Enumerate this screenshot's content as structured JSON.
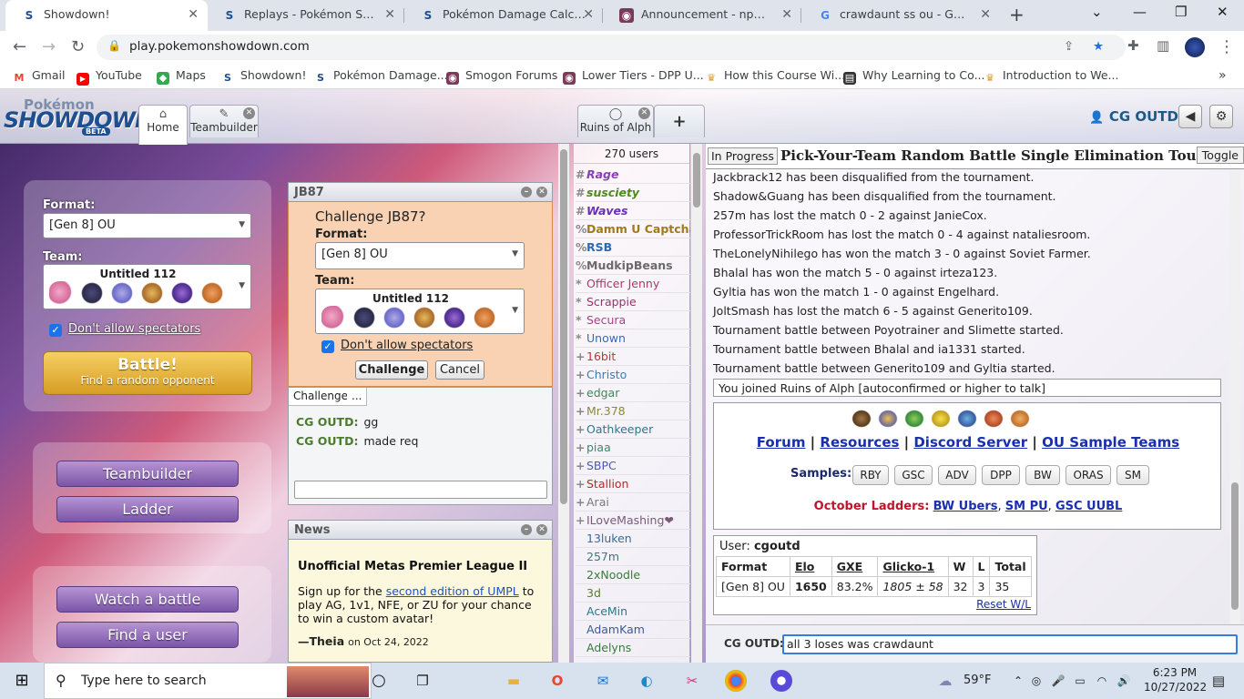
{
  "browser": {
    "tabs": [
      {
        "title": "Showdown!",
        "icon": "showdown-icon",
        "active": true
      },
      {
        "title": "Replays - Pokémon Showdow",
        "icon": "showdown-icon"
      },
      {
        "title": "Pokémon Damage Calculator",
        "icon": "showdown-icon"
      },
      {
        "title": "Announcement - np: SS OU S",
        "icon": "smogon-icon"
      },
      {
        "title": "crawdaunt ss ou - Google Se",
        "icon": "google-icon"
      }
    ],
    "url": "play.pokemonshowdown.com",
    "bookmarks": [
      "Gmail",
      "YouTube",
      "Maps",
      "Showdown!",
      "Pokémon Damage...",
      "Smogon Forums",
      "Lower Tiers - DPP U...",
      "How this Course Wi...",
      "Why Learning to Co...",
      "Introduction to We..."
    ]
  },
  "header": {
    "logo_top": "Pokémon",
    "logo_main": "SHOWDOWN!",
    "logo_badge": "BETA",
    "tabs": {
      "home": "Home",
      "teambuilder": "Teambuilder",
      "room": "Ruins of Alph",
      "add": "+"
    },
    "username": "CG OUTD"
  },
  "mainmenu": {
    "format_label": "Format:",
    "format_value": "[Gen 8] OU",
    "team_label": "Team:",
    "team_name": "Untitled 112",
    "spectators_label": "Don't allow spectators",
    "battle_title": "Battle!",
    "battle_sub": "Find a random opponent",
    "teambuilder": "Teambuilder",
    "ladder": "Ladder",
    "watch": "Watch a battle",
    "find_user": "Find a user"
  },
  "challenge": {
    "window_title": "JB87",
    "prompt": "Challenge JB87?",
    "format_label": "Format:",
    "format_value": "[Gen 8] OU",
    "team_label": "Team:",
    "team_name": "Untitled 112",
    "spectators_label": "Don't allow spectators",
    "challenge_button": "Challenge",
    "cancel_button": "Cancel",
    "tab_challenge": "Challenge",
    "tab_more": "...",
    "messages": [
      {
        "user": "CG OUTD:",
        "text": "gg"
      },
      {
        "user": "CG OUTD:",
        "text": "made req"
      }
    ]
  },
  "news": {
    "title": "News",
    "headline": "Unofficial Metas Premier League II",
    "body_before": "Sign up for the ",
    "link": "second edition of UMPL",
    "body_after": " to play AG, 1v1, NFE, or ZU for your chance to win a custom avatar!",
    "author": "—Theia",
    "date": "on Oct 24, 2022"
  },
  "userlist": {
    "count": "270 users",
    "users": [
      {
        "group": "#",
        "name": "Rage",
        "color": "#8a3fb5",
        "style": "bi"
      },
      {
        "group": "#",
        "name": "susciety",
        "color": "#4f8a1a",
        "style": "bi"
      },
      {
        "group": "#",
        "name": "Waves",
        "color": "#6a2fb5",
        "style": "bi"
      },
      {
        "group": "%",
        "name": "Damm U Captcha",
        "color": "#a07a1a",
        "style": "b"
      },
      {
        "group": "%",
        "name": "RSB",
        "color": "#2a6ab5",
        "style": "b"
      },
      {
        "group": "%",
        "name": "MudkipBeans",
        "color": "#6a6a6a",
        "style": "b"
      },
      {
        "group": "*",
        "name": "Officer Jenny",
        "color": "#b5336a",
        "style": ""
      },
      {
        "group": "*",
        "name": "Scrappie",
        "color": "#a0306a",
        "style": ""
      },
      {
        "group": "*",
        "name": "Secura",
        "color": "#b53a8a",
        "style": ""
      },
      {
        "group": "*",
        "name": "Unown",
        "color": "#3a6ab5",
        "style": ""
      },
      {
        "group": "+",
        "name": "16bit",
        "color": "#b53a3a",
        "style": ""
      },
      {
        "group": "+",
        "name": "Christo",
        "color": "#3a7ab5",
        "style": ""
      },
      {
        "group": "+",
        "name": "edgar",
        "color": "#3a8a5a",
        "style": ""
      },
      {
        "group": "+",
        "name": "Mr.378",
        "color": "#8a8a3a",
        "style": ""
      },
      {
        "group": "+",
        "name": "Oathkeeper",
        "color": "#2a7a8a",
        "style": ""
      },
      {
        "group": "+",
        "name": "piaa",
        "color": "#3a8a6a",
        "style": ""
      },
      {
        "group": "+",
        "name": "SBPC",
        "color": "#4a5ab5",
        "style": ""
      },
      {
        "group": "+",
        "name": "Stallion",
        "color": "#b52a2a",
        "style": ""
      },
      {
        "group": "+",
        "name": "Arai",
        "color": "#7a7a7a",
        "style": ""
      },
      {
        "group": "+",
        "name": "ILoveMashing❤",
        "color": "#7a5a7a",
        "style": ""
      },
      {
        "group": "",
        "name": "13luken",
        "color": "#3a6a9a",
        "style": ""
      },
      {
        "group": "",
        "name": "257m",
        "color": "#3a7a7a",
        "style": ""
      },
      {
        "group": "",
        "name": "2xNoodle",
        "color": "#3a7a3a",
        "style": ""
      },
      {
        "group": "",
        "name": "3d",
        "color": "#5a7a2a",
        "style": ""
      },
      {
        "group": "",
        "name": "AceMin",
        "color": "#2a7a8a",
        "style": ""
      },
      {
        "group": "",
        "name": "AdamKam",
        "color": "#3a5a9a",
        "style": ""
      },
      {
        "group": "",
        "name": "Adelyns",
        "color": "#3a7a3a",
        "style": ""
      }
    ]
  },
  "room": {
    "status": "In Progress",
    "tournament_title": "Pick-Your-Team Random Battle Single Elimination Tournament",
    "toggle": "Toggle",
    "log": [
      "Jackbrack12 has been disqualified from the tournament.",
      "Shadow&Guang has been disqualified from the tournament.",
      "257m has lost the match 0 - 2 against JanieCox.",
      "ProfessorTrickRoom has lost the match 0 - 4 against nataliesroom.",
      "TheLonelyNihilego has won the match 3 - 0 against Soviet Farmer.",
      "Bhalal has won the match 5 - 0 against irteza123.",
      "Gyltia has won the match 1 - 0 against Engelhard.",
      "JoltSmash has lost the match 6 - 5 against Generito109.",
      "Tournament battle between Poyotrainer and Slimette started.",
      "Tournament battle between Bhalal and ia1331 started.",
      "Tournament battle between Generito109 and Gyltia started."
    ],
    "joined": "You joined Ruins of Alph [autoconfirmed or higher to talk]",
    "links": [
      "Forum",
      "Resources",
      "Discord Server",
      "OU Sample Teams"
    ],
    "samples_label": "Samples:",
    "samples": [
      "RBY",
      "GSC",
      "ADV",
      "DPP",
      "BW",
      "ORAS",
      "SM"
    ],
    "ladders_label": "October Ladders:",
    "ladders": [
      "BW Ubers",
      "SM PU",
      "GSC UUBL"
    ],
    "stats": {
      "user_label": "User:",
      "user": "cgoutd",
      "headers": [
        "Format",
        "Elo",
        "GXE",
        "Glicko-1",
        "W",
        "L",
        "Total"
      ],
      "row": [
        "[Gen 8] OU",
        "1650",
        "83.2%",
        "1805 ± 58",
        "32",
        "3",
        "35"
      ],
      "reset": "Reset W/L"
    },
    "chat_user": "CG OUTD:",
    "chat_input": "all 3 loses was crawdaunt"
  },
  "taskbar": {
    "search_placeholder": "Type here to search",
    "weather": "59°F",
    "time": "6:23 PM",
    "date": "10/27/2022"
  }
}
